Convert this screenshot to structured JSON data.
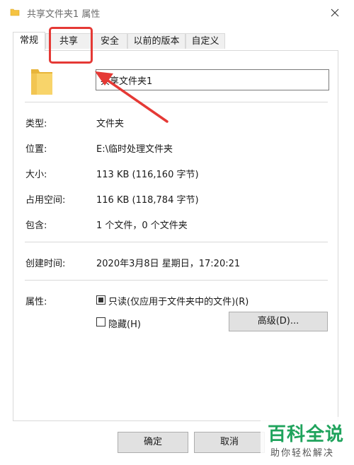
{
  "window": {
    "title": "共享文件夹1 属性",
    "icon": "folder-icon",
    "close_icon": "close-icon"
  },
  "tabs": [
    {
      "label": "常规",
      "active": true
    },
    {
      "label": "共享",
      "active": false
    },
    {
      "label": "安全",
      "active": false
    },
    {
      "label": "以前的版本",
      "active": false
    },
    {
      "label": "自定义",
      "active": false
    }
  ],
  "general": {
    "folder_name": "共享文件夹1",
    "rows": [
      {
        "label": "类型:",
        "value": "文件夹"
      },
      {
        "label": "位置:",
        "value": "E:\\临时处理文件夹"
      },
      {
        "label": "大小:",
        "value": "113 KB (116,160 字节)"
      },
      {
        "label": "占用空间:",
        "value": "116 KB (118,784 字节)"
      },
      {
        "label": "包含:",
        "value": "1 个文件，0 个文件夹"
      },
      {
        "label": "创建时间:",
        "value": "2020年3月8日 星期日，17:20:21"
      }
    ],
    "attributes_label": "属性:",
    "readonly_label": "只读(仅应用于文件夹中的文件)(R)",
    "hidden_label": "隐藏(H)",
    "advanced_button": "高级(D)..."
  },
  "footer": {
    "ok": "确定",
    "cancel": "取消"
  },
  "watermark": {
    "main": "百科全说",
    "sub": "助你轻松解决"
  },
  "colors": {
    "annotation": "#e53935",
    "folder": "#f5c342",
    "watermark": "#1fa35c"
  }
}
